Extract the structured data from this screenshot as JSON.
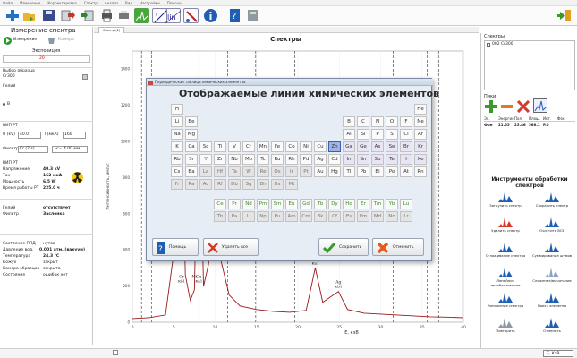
{
  "menu": [
    "Файл",
    "Измерение",
    "Корректировка",
    "Спектр",
    "Анализ",
    "Вид",
    "Настройки",
    "Помощь"
  ],
  "tab_label": "Спектр (2)",
  "left": {
    "title": "Измерение спектра",
    "measure_btn": "Измерение",
    "camera_btn": "Камера",
    "exposure_label": "Экспозиция",
    "exposure_value": "20",
    "sample_label": "Выбор образца",
    "sample_value": "Cr300",
    "medium_label": "Гелий",
    "b_label": "В",
    "kv_label": "U (kV)",
    "kv_value": "40.0",
    "ma_label": "I (мкА)",
    "ma_value": "160",
    "filter_label": "Фильтр",
    "filter_value": "Cr (7 s)",
    "focus_value": "<= 4.00 мм",
    "tube_label": "ВИП РТ",
    "rows": [
      {
        "label": "Напряжение",
        "value": "40.3 kV"
      },
      {
        "label": "Ток",
        "value": "162 мкА"
      },
      {
        "label": "Мощность",
        "value": "6.5 W"
      },
      {
        "label": "Время работы РТ",
        "value": "225.0 ч"
      }
    ],
    "rows2": [
      {
        "label": "Гелий",
        "value": "отсутствует"
      },
      {
        "label": "Фильтр",
        "value": "Заслонка"
      }
    ],
    "rows3": [
      {
        "label": "Состояние ППД",
        "value": "нутов"
      },
      {
        "label": "Давление вод.",
        "value": "0.001 атм. (вакуум)"
      },
      {
        "label": "Температура",
        "value": "24.3 °С"
      },
      {
        "label": "Кожух",
        "value": "закрыт"
      },
      {
        "label": "Камера образцов",
        "value": "закрыта"
      },
      {
        "label": "Состояние",
        "value": "ошибок нет"
      }
    ]
  },
  "chart": {
    "title": "Спектры",
    "xlabel": "E, кэВ",
    "ylabel": "Интенсивность, имп/с",
    "peak_labels": [
      {
        "text": "Cu",
        "sub": "Ka1",
        "x": 8.04
      },
      {
        "text": "Cr",
        "sub": "Kb1",
        "x": 5.95
      },
      {
        "text": "Ni",
        "sub": "",
        "x": 7.47
      },
      {
        "text": "As",
        "sub": "La1",
        "x": 10.5
      },
      {
        "text": "Ag",
        "sub": "Ka1",
        "x": 22.1
      },
      {
        "text": "Ag",
        "sub": "Kb1",
        "x": 24.9
      }
    ],
    "yaxis_ticks": [
      "0",
      "200",
      "400",
      "600",
      "800",
      "1000",
      "1200",
      "1400"
    ]
  },
  "chart_data": {
    "type": "line",
    "xlabel": "E, кэВ",
    "ylabel": "Интенсивность, имп/с",
    "xlim": [
      0,
      40
    ],
    "xticks": [
      0,
      5,
      10,
      15,
      20,
      25,
      30,
      35,
      40
    ],
    "ylim": [
      0,
      1500
    ],
    "series": [
      {
        "name": "Cr300",
        "x": [
          0,
          2,
          4,
          5.4,
          5.9,
          6.4,
          7.0,
          7.5,
          8.0,
          8.6,
          9.2,
          9.6,
          10.5,
          11.7,
          13,
          15,
          17,
          19,
          21,
          22.1,
          23,
          24.9,
          26,
          28,
          30,
          32,
          34,
          36,
          38,
          40
        ],
        "y": [
          20,
          25,
          40,
          520,
          1280,
          260,
          120,
          180,
          1350,
          200,
          320,
          500,
          380,
          150,
          90,
          70,
          60,
          55,
          65,
          300,
          110,
          170,
          70,
          50,
          45,
          40,
          35,
          30,
          28,
          25
        ]
      }
    ]
  },
  "modal": {
    "window_title": "Периодическая таблица химических элементов",
    "heading": "Отображаемые линии химических элементов",
    "help": "Помощь",
    "clear_all": "Удалить все",
    "save": "Сохранить",
    "cancel": "Отменить",
    "rows": [
      [
        "H",
        "",
        "",
        "",
        "",
        "",
        "",
        "",
        "",
        "",
        "",
        "",
        "",
        "",
        "",
        "",
        "",
        "He"
      ],
      [
        "Li",
        "Be",
        "",
        "",
        "",
        "",
        "",
        "",
        "",
        "",
        "",
        "",
        "B",
        "C",
        "N",
        "O",
        "F",
        "Ne"
      ],
      [
        "Na",
        "Mg",
        "",
        "",
        "",
        "",
        "",
        "",
        "",
        "",
        "",
        "",
        "Al",
        "Si",
        "P",
        "S",
        "Cl",
        "Ar"
      ],
      [
        "K",
        "Ca",
        "Sc",
        "Ti",
        "V",
        "Cr",
        "Mn",
        "Fe",
        "Co",
        "Ni",
        "Cu",
        "Zn",
        "Ga",
        "Ge",
        "As",
        "Se",
        "Br",
        "Kr"
      ],
      [
        "Rb",
        "Sr",
        "Y",
        "Zr",
        "Nb",
        "Mo",
        "Tc",
        "Ru",
        "Rh",
        "Pd",
        "Ag",
        "Cd",
        "In",
        "Sn",
        "Sb",
        "Te",
        "I",
        "Xe"
      ],
      [
        "Cs",
        "Ba",
        "La",
        "Hf",
        "Ta",
        "W",
        "Re",
        "Os",
        "Ir",
        "Pt",
        "Au",
        "Hg",
        "Tl",
        "Pb",
        "Bi",
        "Po",
        "At",
        "Rn"
      ],
      [
        "Fr",
        "Ra",
        "Ac",
        "Rf",
        "Db",
        "Sg",
        "Bh",
        "Hs",
        "Mt",
        "",
        "",
        "",
        "",
        "",
        "",
        "",
        "",
        ""
      ]
    ],
    "lanth": [
      "Ce",
      "Pr",
      "Nd",
      "Pm",
      "Sm",
      "Eu",
      "Gd",
      "Tb",
      "Dy",
      "Ho",
      "Er",
      "Tm",
      "Yb",
      "Lu"
    ],
    "actin": [
      "Th",
      "Pa",
      "U",
      "Np",
      "Pu",
      "Am",
      "Cm",
      "Bk",
      "Cf",
      "Es",
      "Fm",
      "Md",
      "No",
      "Lr"
    ],
    "selected": "Zn"
  },
  "right": {
    "spectra_label": "Спектры",
    "spectrum_item": "002 Cr300",
    "peaks_label": "Пики",
    "peaks_headers": [
      "Эл.",
      "Энергия",
      "Пол.",
      "Площ.",
      "Инт.",
      "Фон"
    ],
    "peaks_row": [
      "Фон",
      "21.55",
      "25.46",
      "568.1",
      "P.0",
      ""
    ],
    "tools_title": "Инструменты обработки спектров",
    "tools": [
      "Загрузить спектр",
      "Сохранить спектр",
      "Удалить спектр",
      "Очистить ВСЕ",
      "Сглаживание спектра",
      "Суммирование шумов",
      "Линейное преобразование",
      "Сложение/вычитание",
      "Умножение спектра",
      "Поиск элемента",
      "Повторить",
      "Отменить"
    ],
    "unit_select": "E, КэВ"
  }
}
